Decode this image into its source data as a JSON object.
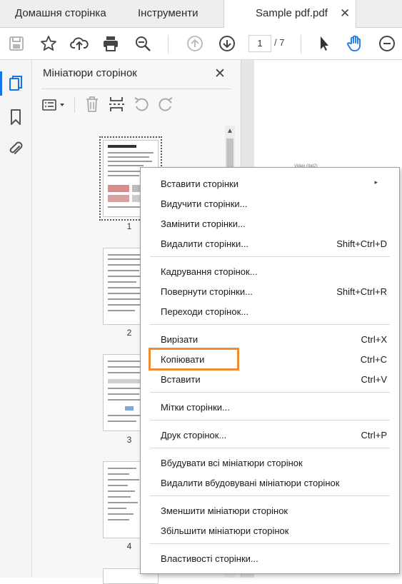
{
  "tabs": [
    {
      "label": "Домашня сторінка"
    },
    {
      "label": "Інструменти"
    },
    {
      "label": "Sample pdf.pdf",
      "close": "✕"
    }
  ],
  "toolbar": {
    "current_page": "1",
    "total_pages": "/ 7"
  },
  "panel": {
    "title": "Мініатюри сторінок",
    "close": "✕",
    "scroll_up": "▲"
  },
  "thumbnails": [
    {
      "number": "1"
    },
    {
      "number": "2"
    },
    {
      "number": "3"
    },
    {
      "number": "4"
    }
  ],
  "document": {
    "stub_text": "Video (tbd2)"
  },
  "menu": {
    "items": [
      {
        "label": "Вставити сторінки",
        "shortcut": "",
        "submenu": "▸"
      },
      {
        "label": "Видучити сторінки...",
        "shortcut": ""
      },
      {
        "label": "Замінити сторінки...",
        "shortcut": ""
      },
      {
        "label": "Видалити сторінки...",
        "shortcut": "Shift+Ctrl+D"
      },
      {
        "label": "Кадрування сторінок...",
        "shortcut": ""
      },
      {
        "label": "Повернути сторінки...",
        "shortcut": "Shift+Ctrl+R"
      },
      {
        "label": "Переходи сторінок...",
        "shortcut": ""
      },
      {
        "label": "Вирізати",
        "shortcut": "Ctrl+X"
      },
      {
        "label": "Копіювати",
        "shortcut": "Ctrl+C"
      },
      {
        "label": "Вставити",
        "shortcut": "Ctrl+V"
      },
      {
        "label": "Мітки сторінки...",
        "shortcut": ""
      },
      {
        "label": "Друк сторінок...",
        "shortcut": "Ctrl+P"
      },
      {
        "label": "Вбудувати всі мініатюри сторінок",
        "shortcut": ""
      },
      {
        "label": "Видалити вбудовувані мініатюри сторінок",
        "shortcut": ""
      },
      {
        "label": "Зменшити мініатюри сторінок",
        "shortcut": ""
      },
      {
        "label": "Збільшити мініатюри сторінок",
        "shortcut": ""
      },
      {
        "label": "Властивості сторінки...",
        "shortcut": ""
      }
    ]
  },
  "colors": {
    "highlight": "#f08c2e",
    "active_tool": "#1473e6"
  },
  "icons": [
    "save-icon",
    "star-icon",
    "cloud-upload-icon",
    "print-icon",
    "zoom-out-search-icon",
    "page-up-icon",
    "page-down-icon",
    "select-arrow-icon",
    "hand-tool-icon",
    "zoom-minus-icon",
    "pages-icon",
    "bookmark-icon",
    "attachment-icon",
    "thumbnail-options-icon",
    "trash-icon",
    "insert-pages-icon",
    "undo-icon",
    "redo-icon"
  ]
}
